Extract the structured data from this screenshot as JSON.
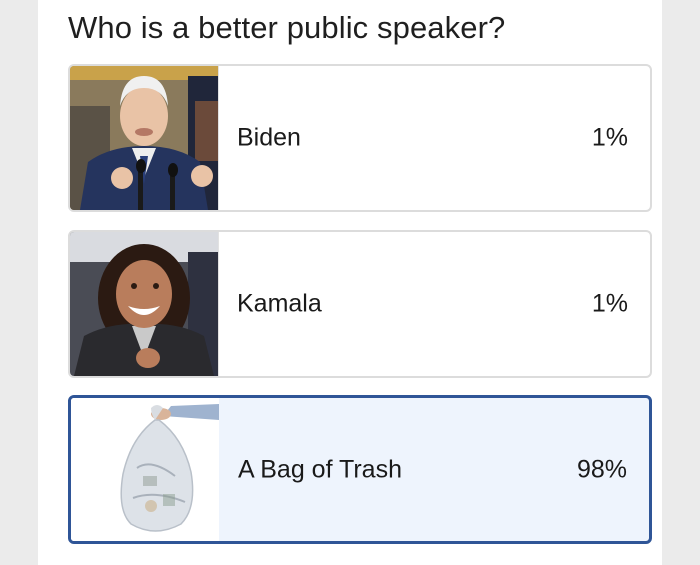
{
  "poll": {
    "question": "Who is a better public speaker?",
    "options": [
      {
        "label": "Biden",
        "percent": "1%",
        "selected": false
      },
      {
        "label": "Kamala",
        "percent": "1%",
        "selected": false
      },
      {
        "label": "A Bag of Trash",
        "percent": "98%",
        "selected": true
      }
    ]
  },
  "colors": {
    "selected_border": "#2f5597",
    "selected_fill": "#eef4fd",
    "option_border": "#dcdcdc"
  }
}
